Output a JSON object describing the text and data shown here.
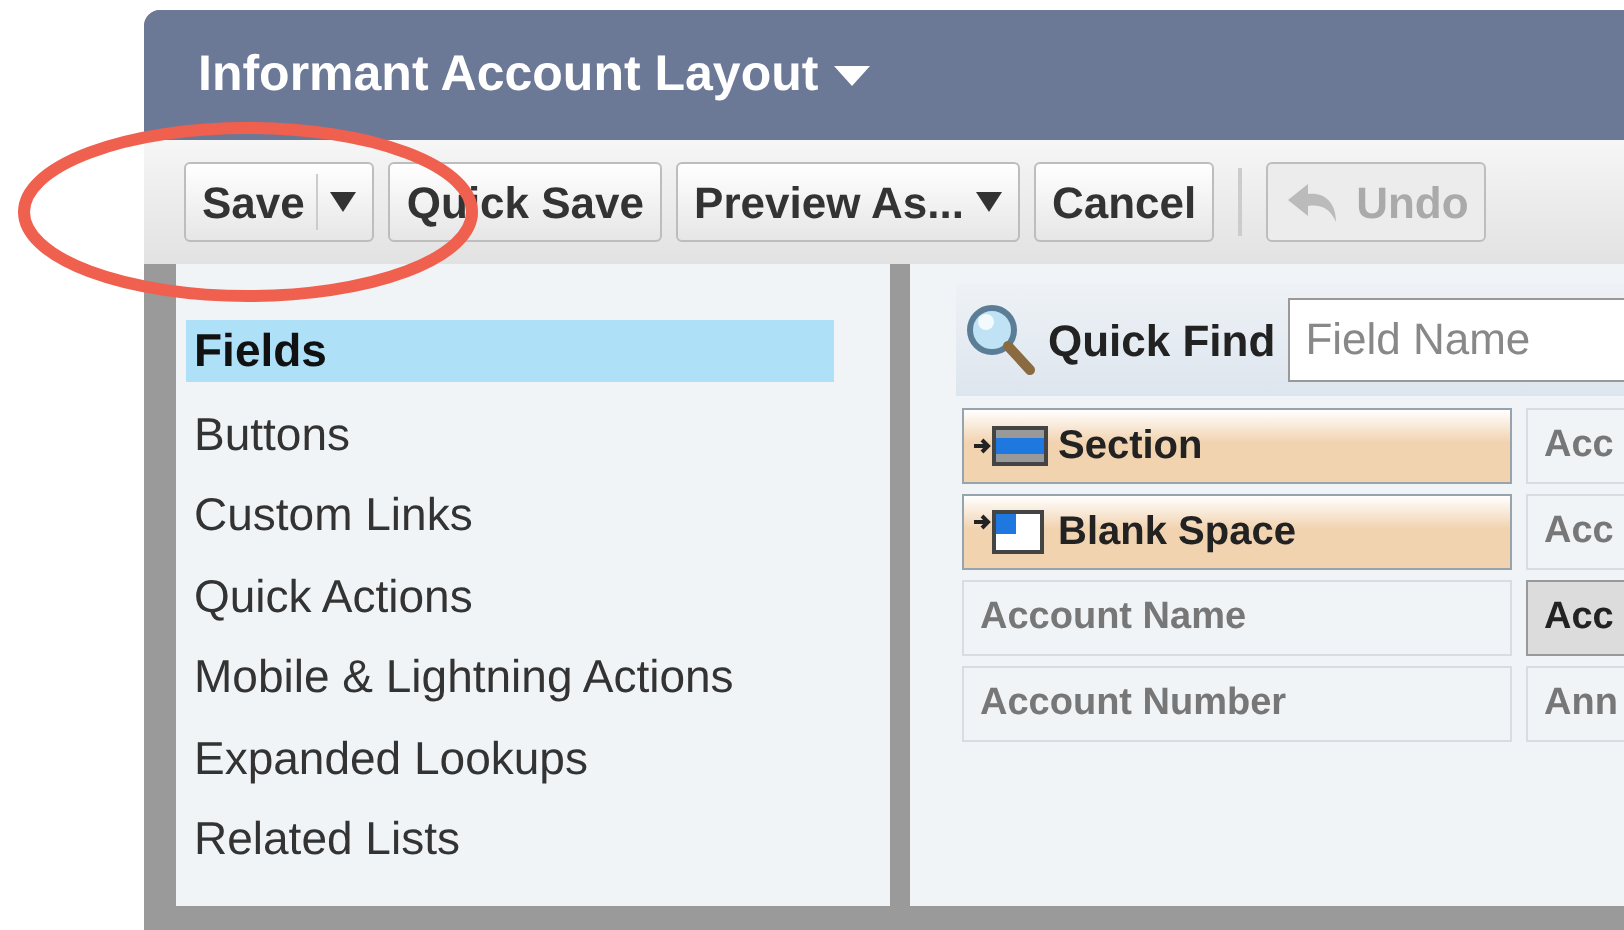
{
  "header": {
    "title": "Informant Account Layout"
  },
  "toolbar": {
    "buttons": [
      {
        "kind": "split",
        "label": "Save",
        "disabled": false
      },
      {
        "kind": "plain",
        "label": "Quick Save",
        "disabled": false
      },
      {
        "kind": "menu",
        "label": "Preview As...",
        "disabled": false
      },
      {
        "kind": "plain",
        "label": "Cancel",
        "disabled": false
      },
      {
        "kind": "undo",
        "label": "Undo",
        "disabled": true
      }
    ]
  },
  "palette": {
    "categories": [
      {
        "label": "Fields",
        "selected": true
      },
      {
        "label": "Buttons",
        "selected": false
      },
      {
        "label": "Custom Links",
        "selected": false
      },
      {
        "label": "Quick Actions",
        "selected": false
      },
      {
        "label": "Mobile & Lightning Actions",
        "selected": false
      },
      {
        "label": "Expanded Lookups",
        "selected": false
      },
      {
        "label": "Related Lists",
        "selected": false
      }
    ]
  },
  "quick_find": {
    "label": "Quick Find",
    "placeholder": "Field Name"
  },
  "field_rows": [
    [
      {
        "kind": "section",
        "label": "Section",
        "selected": false
      },
      {
        "kind": "field",
        "label": "Acc",
        "selected": false
      }
    ],
    [
      {
        "kind": "blank",
        "label": "Blank Space",
        "selected": false
      },
      {
        "kind": "field",
        "label": "Acc",
        "selected": false
      }
    ],
    [
      {
        "kind": "field",
        "label": "Account Name",
        "selected": false
      },
      {
        "kind": "field",
        "label": "Acc",
        "selected": true
      }
    ],
    [
      {
        "kind": "field",
        "label": "Account Number",
        "selected": false
      },
      {
        "kind": "field",
        "label": "Ann",
        "selected": false
      }
    ]
  ]
}
